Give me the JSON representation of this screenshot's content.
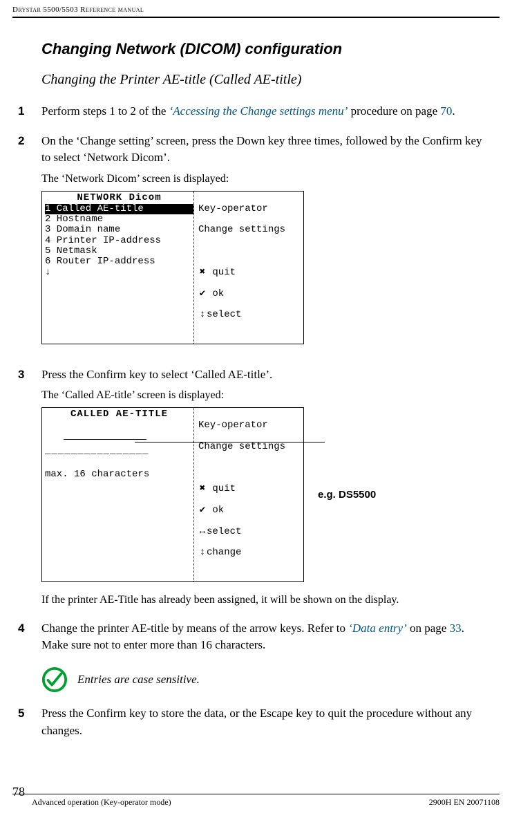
{
  "running_head": "Drystar 5500/5503 Reference manual",
  "section_title": "Changing Network (DICOM) configuration",
  "subtitle": "Changing the Printer AE-title (Called AE-title)",
  "steps": {
    "s1": {
      "num": "1",
      "pre": "Perform steps 1 to 2 of the ",
      "link": "‘Accessing the Change settings menu’",
      "mid": " procedure on page ",
      "page": "70",
      "post": "."
    },
    "s2": {
      "num": "2",
      "text": "On the ‘Change setting’ screen, press the Down key three times, followed by the Confirm key to select ‘Network Dicom’.",
      "caption": "The ‘Network Dicom’ screen is displayed:"
    },
    "s3": {
      "num": "3",
      "text": "Press the Confirm key to select ‘Called AE-title’.",
      "caption": "The ‘Called AE-title’ screen is displayed:",
      "note_after": "If the printer AE-Title has already been assigned, it will be shown on the display."
    },
    "s4": {
      "num": "4",
      "pre": "Change the printer AE-title by means of the arrow keys. Refer to ",
      "link": "‘Data entry’",
      "mid": " on page ",
      "page": "33",
      "post": ". Make sure not to enter more than 16 characters."
    },
    "s5": {
      "num": "5",
      "text": "Press the Confirm key to store the data, or the Escape key to quit the procedure without any changes."
    }
  },
  "screenshot1": {
    "title": "NETWORK Dicom",
    "selected": "1 Called AE-title",
    "lines": [
      "2 Hostname",
      "3 Domain name",
      "4 Printer IP-address",
      "5 Netmask",
      "6 Router IP-address",
      "↓"
    ],
    "right_header1": "Key-operator",
    "right_header2": "Change settings",
    "right_lines": {
      "quit": "quit",
      "ok": "ok",
      "select": "select"
    }
  },
  "screenshot2": {
    "title": "CALLED AE-TITLE",
    "input_placeholder": "________________",
    "footer_line": "max. 16 characters",
    "right_header1": "Key-operator",
    "right_header2": "Change settings",
    "right_lines": {
      "quit": "quit",
      "ok": "ok",
      "select": "select",
      "change": "change"
    },
    "eg_label": "e.g. DS5500"
  },
  "tip_text": "Entries are case sensitive.",
  "footer": {
    "page_number": "78",
    "left": "Advanced operation (Key-operator mode)",
    "right": "2900H EN 20071108"
  },
  "icons": {
    "x": "✖",
    "check": "✔",
    "updown": "↕",
    "leftright": "↔"
  }
}
